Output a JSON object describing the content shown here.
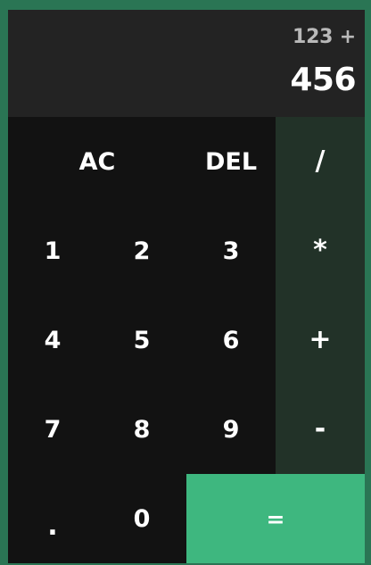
{
  "display": {
    "previous": "123 +",
    "current": "456"
  },
  "keys": {
    "ac": "AC",
    "del": "DEL",
    "divide": "/",
    "one": "1",
    "two": "2",
    "three": "3",
    "multiply": "*",
    "four": "4",
    "five": "5",
    "six": "6",
    "plus": "+",
    "seven": "7",
    "eight": "8",
    "nine": "9",
    "minus": "-",
    "decimal": ".",
    "zero": "0",
    "equals": "="
  },
  "colors": {
    "page_background": "#2a7554",
    "display_background": "#232323",
    "keypad_background": "#121212",
    "operator_background": "#223228",
    "equals_background": "#3eb77f",
    "text": "#ffffff",
    "secondary_text": "#b9b9b9"
  }
}
